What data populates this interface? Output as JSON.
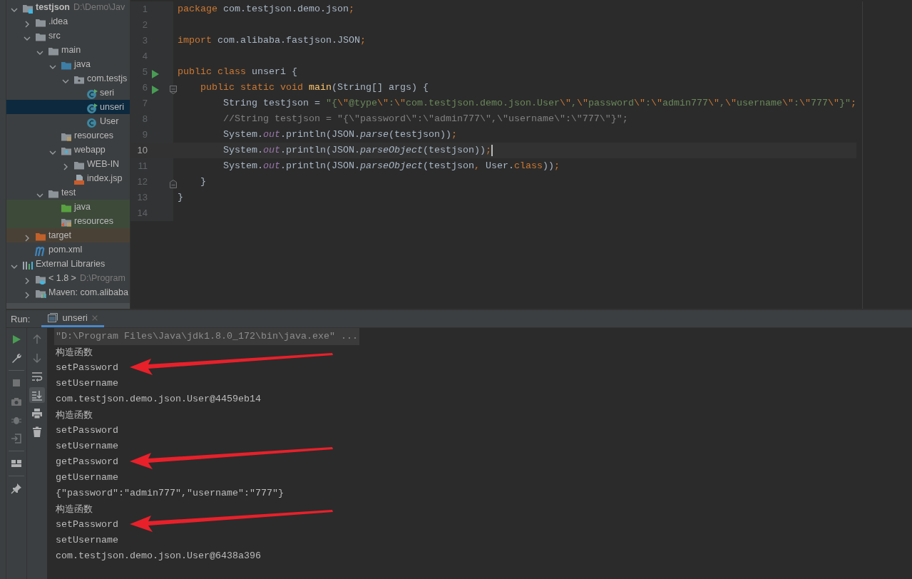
{
  "project_tree": [
    {
      "label": "testjson",
      "hint": "D:\\Demo\\Jav",
      "kind": "module",
      "expanded": true,
      "selected": false,
      "children": [
        {
          "label": ".idea",
          "kind": "folder",
          "expanded": false,
          "selected": false
        },
        {
          "label": "src",
          "kind": "folder",
          "expanded": true,
          "selected": false,
          "children": [
            {
              "label": "main",
              "kind": "folder",
              "expanded": true,
              "selected": false,
              "children": [
                {
                  "label": "java",
                  "kind": "source-folder",
                  "expanded": true,
                  "selected": false,
                  "children": [
                    {
                      "label": "com.testjs",
                      "kind": "package",
                      "expanded": true,
                      "selected": false,
                      "children": [
                        {
                          "label": "seri",
                          "kind": "runnable-class",
                          "selected": false
                        },
                        {
                          "label": "unseri",
                          "kind": "runnable-class",
                          "selected": true
                        },
                        {
                          "label": "User",
                          "kind": "class",
                          "selected": false
                        }
                      ]
                    }
                  ]
                },
                {
                  "label": "resources",
                  "kind": "resources-folder",
                  "selected": false
                },
                {
                  "label": "webapp",
                  "kind": "web-folder",
                  "expanded": true,
                  "selected": false,
                  "children": [
                    {
                      "label": "WEB-IN",
                      "kind": "folder",
                      "expanded": false,
                      "selected": false
                    },
                    {
                      "label": "index.jsp",
                      "kind": "jsp",
                      "selected": false
                    }
                  ]
                }
              ]
            },
            {
              "label": "test",
              "kind": "folder",
              "expanded": true,
              "selected": false,
              "children": [
                {
                  "label": "java",
                  "kind": "test-source-folder",
                  "selected": false
                },
                {
                  "label": "resources",
                  "kind": "test-resources-folder",
                  "selected": false
                }
              ]
            }
          ]
        },
        {
          "label": "target",
          "kind": "excluded-folder",
          "expanded": false,
          "selected": false
        },
        {
          "label": "pom.xml",
          "kind": "maven",
          "selected": false
        }
      ]
    },
    {
      "label": "External Libraries",
      "kind": "libraries",
      "expanded": true,
      "selected": false,
      "children": [
        {
          "label": "< 1.8 >",
          "hint": "D:\\Program",
          "kind": "jdk",
          "expanded": false,
          "selected": false
        },
        {
          "label": "Maven: com.alibaba",
          "kind": "library",
          "expanded": false,
          "selected": false
        }
      ]
    }
  ],
  "editor": {
    "lines": [
      {
        "number": "1",
        "kind": "plain",
        "run": false,
        "current": false,
        "tokens": [
          {
            "kind": "kw",
            "text": "package "
          },
          {
            "kind": "plain",
            "text": "com.testjson.demo.json"
          },
          {
            "kind": "kw",
            "text": ";"
          }
        ]
      },
      {
        "number": "2",
        "kind": "plain",
        "run": false,
        "current": false
      },
      {
        "number": "3",
        "kind": "plain",
        "run": false,
        "current": false,
        "tokens": [
          {
            "kind": "kw",
            "text": "import "
          },
          {
            "kind": "plain",
            "text": "com.alibaba.fastjson.JSON"
          },
          {
            "kind": "kw",
            "text": ";"
          }
        ]
      },
      {
        "number": "4",
        "kind": "plain",
        "run": false,
        "current": false
      },
      {
        "number": "5",
        "kind": "plain",
        "run": true,
        "current": false,
        "tokens": [
          {
            "kind": "kw",
            "text": "public class "
          },
          {
            "kind": "plain",
            "text": "unseri {"
          }
        ]
      },
      {
        "number": "6",
        "kind": "fold-start",
        "run": true,
        "current": false,
        "tokens": [
          {
            "kind": "kw",
            "text": "    public static void "
          },
          {
            "kind": "decl",
            "text": "main"
          },
          {
            "kind": "plain",
            "text": "(String[] args) {"
          }
        ]
      },
      {
        "number": "7",
        "kind": "plain",
        "run": false,
        "current": false,
        "tokens": [
          {
            "kind": "plain",
            "text": "        String testjson = "
          },
          {
            "kind": "str",
            "text": "\"{"
          },
          {
            "kind": "esc",
            "text": "\\\""
          },
          {
            "kind": "str",
            "text": "@type"
          },
          {
            "kind": "esc",
            "text": "\\\""
          },
          {
            "kind": "str",
            "text": ":"
          },
          {
            "kind": "esc",
            "text": "\\\""
          },
          {
            "kind": "str",
            "text": "com.testjson.demo.json.User"
          },
          {
            "kind": "esc",
            "text": "\\\""
          },
          {
            "kind": "str",
            "text": ","
          },
          {
            "kind": "esc",
            "text": "\\\""
          },
          {
            "kind": "str",
            "text": "password"
          },
          {
            "kind": "esc",
            "text": "\\\""
          },
          {
            "kind": "str",
            "text": ":"
          },
          {
            "kind": "esc",
            "text": "\\\""
          },
          {
            "kind": "str",
            "text": "admin777"
          },
          {
            "kind": "esc",
            "text": "\\\""
          },
          {
            "kind": "str",
            "text": ","
          },
          {
            "kind": "esc",
            "text": "\\\""
          },
          {
            "kind": "str",
            "text": "username"
          },
          {
            "kind": "esc",
            "text": "\\\""
          },
          {
            "kind": "str",
            "text": ":"
          },
          {
            "kind": "esc",
            "text": "\\\""
          },
          {
            "kind": "str",
            "text": "777"
          },
          {
            "kind": "esc",
            "text": "\\\""
          },
          {
            "kind": "str",
            "text": "}\""
          },
          {
            "kind": "kw",
            "text": ";"
          }
        ]
      },
      {
        "number": "8",
        "kind": "plain",
        "run": false,
        "current": false,
        "tokens": [
          {
            "kind": "comment",
            "text": "        //String testjson = \"{\\\"password\\\":\\\"admin777\\\",\\\"username\\\":\\\"777\\\"}\";"
          }
        ]
      },
      {
        "number": "9",
        "kind": "plain",
        "run": false,
        "current": false,
        "tokens": [
          {
            "kind": "plain",
            "text": "        System."
          },
          {
            "kind": "field",
            "text": "out"
          },
          {
            "kind": "plain",
            "text": ".println(JSON."
          },
          {
            "kind": "call",
            "text": "parse"
          },
          {
            "kind": "plain",
            "text": "(testjson))"
          },
          {
            "kind": "kw",
            "text": ";"
          }
        ]
      },
      {
        "number": "10",
        "kind": "plain",
        "run": false,
        "current": true,
        "tokens": [
          {
            "kind": "plain",
            "text": "        System."
          },
          {
            "kind": "field",
            "text": "out"
          },
          {
            "kind": "plain",
            "text": ".println(JSON."
          },
          {
            "kind": "call",
            "text": "parseObject"
          },
          {
            "kind": "plain",
            "text": "(testjson))"
          },
          {
            "kind": "kw",
            "text": ";"
          }
        ]
      },
      {
        "number": "11",
        "kind": "plain",
        "run": false,
        "current": false,
        "tokens": [
          {
            "kind": "plain",
            "text": "        System."
          },
          {
            "kind": "field",
            "text": "out"
          },
          {
            "kind": "plain",
            "text": ".println(JSON."
          },
          {
            "kind": "call",
            "text": "parseObject"
          },
          {
            "kind": "plain",
            "text": "(testjson"
          },
          {
            "kind": "kw",
            "text": ","
          },
          {
            "kind": "plain",
            "text": " User."
          },
          {
            "kind": "kw",
            "text": "class"
          },
          {
            "kind": "plain",
            "text": "))"
          },
          {
            "kind": "kw",
            "text": ";"
          }
        ]
      },
      {
        "number": "12",
        "kind": "fold-end",
        "run": false,
        "current": false,
        "tokens": [
          {
            "kind": "plain",
            "text": "    }"
          }
        ]
      },
      {
        "number": "13",
        "kind": "plain",
        "run": false,
        "current": false,
        "tokens": [
          {
            "kind": "plain",
            "text": "}"
          }
        ]
      },
      {
        "number": "14",
        "kind": "plain",
        "run": false,
        "current": false
      }
    ]
  },
  "run_panel": {
    "label": "Run:",
    "tabs": [
      {
        "label": "unseri",
        "selected": true
      }
    ],
    "toolbar_primary": [
      {
        "kind": "run",
        "disabled": false
      },
      {
        "kind": "wrench",
        "disabled": false
      },
      {
        "kind": "separator"
      },
      {
        "kind": "stop",
        "disabled": true
      },
      {
        "kind": "camera",
        "disabled": true
      },
      {
        "kind": "bug",
        "disabled": true
      },
      {
        "kind": "exit",
        "disabled": true
      },
      {
        "kind": "separator"
      },
      {
        "kind": "layout",
        "disabled": false
      },
      {
        "kind": "separator"
      },
      {
        "kind": "pin",
        "disabled": false
      }
    ],
    "toolbar_secondary": [
      {
        "kind": "up",
        "disabled": true,
        "selected": false
      },
      {
        "kind": "down",
        "disabled": true,
        "selected": false
      },
      {
        "kind": "wrap",
        "disabled": false,
        "selected": false
      },
      {
        "kind": "scroll-end",
        "disabled": false,
        "selected": true
      },
      {
        "kind": "print",
        "disabled": false,
        "selected": false
      },
      {
        "kind": "trash",
        "disabled": false,
        "selected": false
      }
    ],
    "output": [
      {
        "text": "\"D:\\Program Files\\Java\\jdk1.8.0_172\\bin\\java.exe\" ...",
        "kind": "command",
        "arrow": false
      },
      {
        "text": "构造函数",
        "kind": "plain",
        "arrow": false
      },
      {
        "text": "setPassword",
        "kind": "plain",
        "arrow": true
      },
      {
        "text": "setUsername",
        "kind": "plain",
        "arrow": false
      },
      {
        "text": "com.testjson.demo.json.User@4459eb14",
        "kind": "plain",
        "arrow": false
      },
      {
        "text": "构造函数",
        "kind": "plain",
        "arrow": false
      },
      {
        "text": "setPassword",
        "kind": "plain",
        "arrow": false
      },
      {
        "text": "setUsername",
        "kind": "plain",
        "arrow": false
      },
      {
        "text": "getPassword",
        "kind": "plain",
        "arrow": true
      },
      {
        "text": "getUsername",
        "kind": "plain",
        "arrow": false
      },
      {
        "text": "{\"password\":\"admin777\",\"username\":\"777\"}",
        "kind": "plain",
        "arrow": false
      },
      {
        "text": "构造函数",
        "kind": "plain",
        "arrow": false
      },
      {
        "text": "setPassword",
        "kind": "plain",
        "arrow": true
      },
      {
        "text": "setUsername",
        "kind": "plain",
        "arrow": false
      },
      {
        "text": "com.testjson.demo.json.User@6438a396",
        "kind": "plain",
        "arrow": false
      }
    ]
  }
}
